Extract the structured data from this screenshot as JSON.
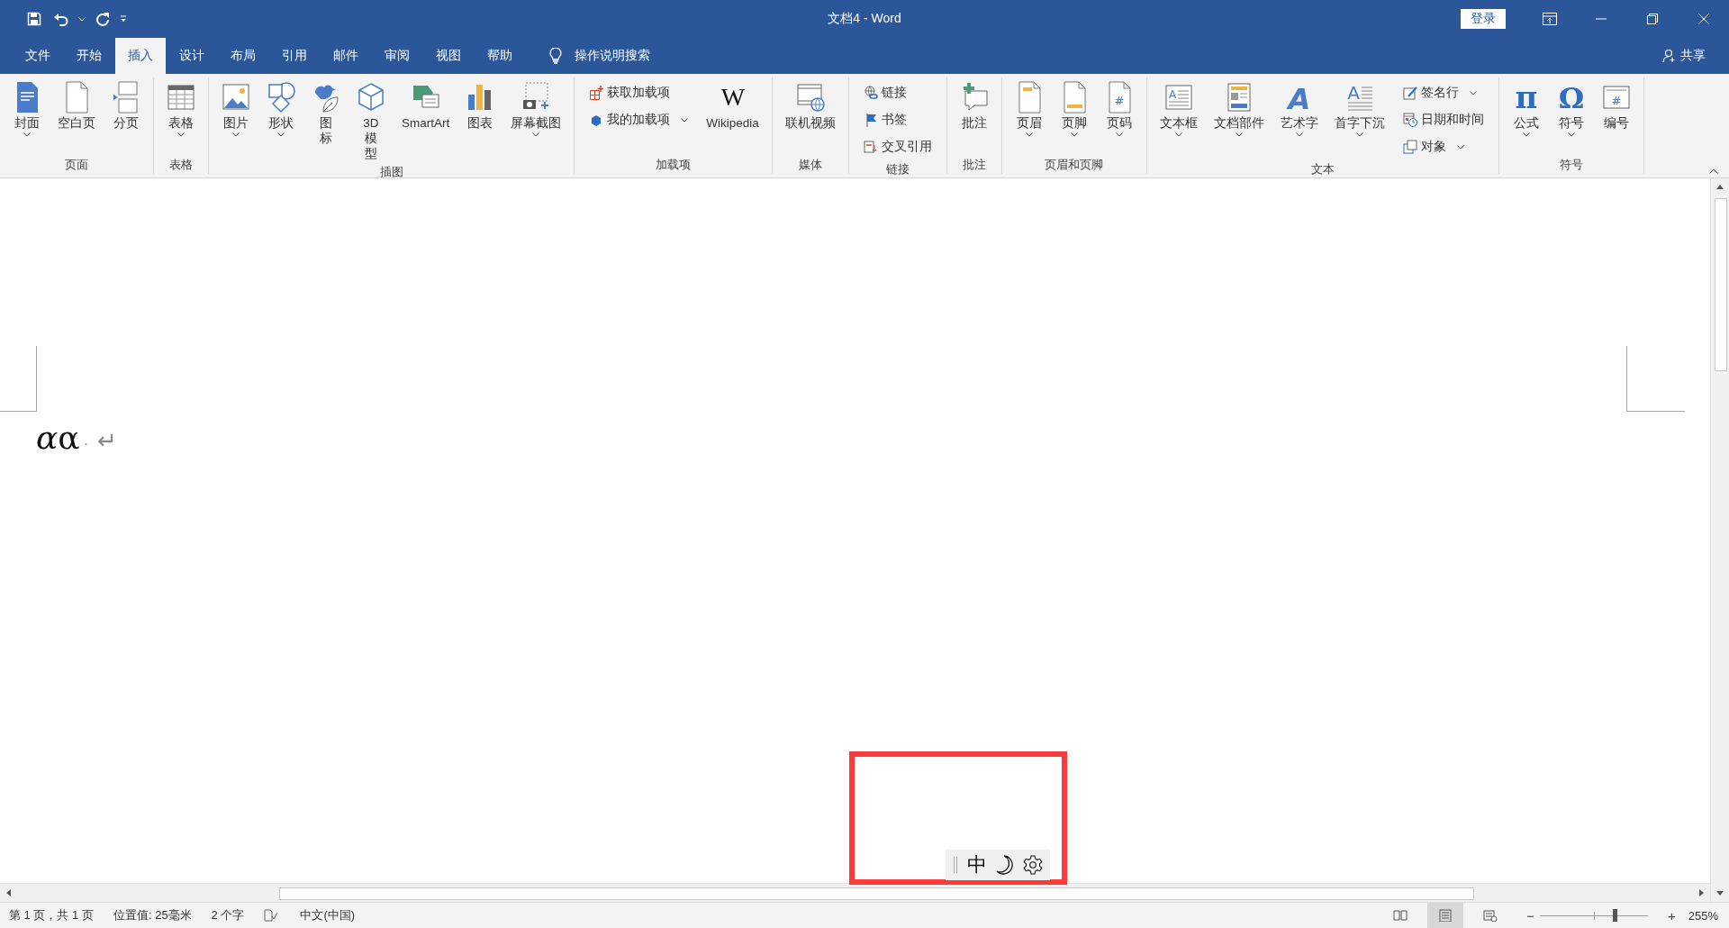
{
  "window": {
    "title": "文档4 - Word"
  },
  "sign_in": "登录",
  "tabs": [
    {
      "label": "文件",
      "selected": false
    },
    {
      "label": "开始",
      "selected": false
    },
    {
      "label": "插入",
      "selected": true
    },
    {
      "label": "设计",
      "selected": false
    },
    {
      "label": "布局",
      "selected": false
    },
    {
      "label": "引用",
      "selected": false
    },
    {
      "label": "邮件",
      "selected": false
    },
    {
      "label": "审阅",
      "selected": false
    },
    {
      "label": "视图",
      "selected": false
    },
    {
      "label": "帮助",
      "selected": false
    }
  ],
  "tell_me": {
    "label": "操作说明搜索"
  },
  "share": "共享",
  "ribbon": {
    "groups": [
      {
        "label": "页面",
        "columns": [
          {
            "kind": "large",
            "label": "封面",
            "dropdown": true
          },
          {
            "kind": "large",
            "label": "空白页",
            "dropdown": false
          },
          {
            "kind": "large",
            "label": "分页",
            "dropdown": false
          }
        ]
      },
      {
        "label": "表格",
        "columns": [
          {
            "kind": "large",
            "label": "表格",
            "dropdown": true
          }
        ]
      },
      {
        "label": "插图",
        "columns": [
          {
            "kind": "large",
            "label": "图片",
            "dropdown": true
          },
          {
            "kind": "large",
            "label": "形状",
            "dropdown": true
          },
          {
            "kind": "large_wrapped",
            "label": "图标",
            "dropdown": false
          },
          {
            "kind": "large_wrapped",
            "label": "3D模型",
            "dropdown": false
          },
          {
            "kind": "large",
            "label": "SmartArt",
            "dropdown": false
          },
          {
            "kind": "large",
            "label": "图表",
            "dropdown": false
          },
          {
            "kind": "large",
            "label": "屏幕截图",
            "dropdown": true
          }
        ]
      },
      {
        "label": "加载项",
        "columns": [
          {
            "kind": "stack",
            "items": [
              {
                "label": "获取加载项",
                "dropdown": false
              },
              {
                "label": "我的加载项",
                "dropdown": true
              }
            ]
          },
          {
            "kind": "large",
            "label": "Wikipedia",
            "glyph": "W",
            "dropdown": false
          }
        ]
      },
      {
        "label": "媒体",
        "columns": [
          {
            "kind": "large",
            "label": "联机视频",
            "dropdown": false
          }
        ]
      },
      {
        "label": "链接",
        "columns": [
          {
            "kind": "stack",
            "items": [
              {
                "label": "链接",
                "dropdown": false
              },
              {
                "label": "书签",
                "dropdown": false
              },
              {
                "label": "交叉引用",
                "dropdown": false
              }
            ]
          }
        ]
      },
      {
        "label": "批注",
        "columns": [
          {
            "kind": "large",
            "label": "批注",
            "dropdown": false
          }
        ]
      },
      {
        "label": "页眉和页脚",
        "columns": [
          {
            "kind": "large",
            "label": "页眉",
            "dropdown": true
          },
          {
            "kind": "large",
            "label": "页脚",
            "dropdown": true
          },
          {
            "kind": "large",
            "label": "页码",
            "glyph": "#",
            "dropdown": true
          }
        ]
      },
      {
        "label": "文本",
        "columns": [
          {
            "kind": "large",
            "label": "文本框",
            "glyph": "A",
            "dropdown": true
          },
          {
            "kind": "large",
            "label": "文档部件",
            "dropdown": true
          },
          {
            "kind": "large",
            "label": "艺术字",
            "glyph": "A",
            "dropdown": true
          },
          {
            "kind": "large",
            "label": "首字下沉",
            "glyph": "A",
            "dropdown": true
          },
          {
            "kind": "stack",
            "items": [
              {
                "label": "签名行",
                "dropdown": true
              },
              {
                "label": "日期和时间",
                "dropdown": false
              },
              {
                "label": "对象",
                "dropdown": true
              }
            ]
          }
        ]
      },
      {
        "label": "符号",
        "columns": [
          {
            "kind": "large",
            "label": "公式",
            "glyph": "π",
            "dropdown": true
          },
          {
            "kind": "large",
            "label": "符号",
            "glyph": "Ω",
            "dropdown": true
          },
          {
            "kind": "large",
            "label": "编号",
            "glyph": "#",
            "dropdown": false
          }
        ]
      }
    ]
  },
  "document": {
    "paragraphs": [
      {
        "runs": [
          {
            "text": "α",
            "italic": true
          },
          {
            "text": "α",
            "italic": false
          }
        ],
        "space_mark": "·",
        "end_mark": "↵"
      }
    ]
  },
  "ime_toolbar": {
    "mode": "中"
  },
  "status_bar": {
    "items": [
      "第 1 页，共 1 页",
      "位置值: 25毫米",
      "2 个字"
    ],
    "language": "中文(中国)",
    "views": [
      {
        "selected": false
      },
      {
        "selected": true
      },
      {
        "selected": false
      }
    ],
    "zoom": {
      "minus": "−",
      "plus": "+",
      "level": 0.7,
      "reading": "255%"
    }
  }
}
